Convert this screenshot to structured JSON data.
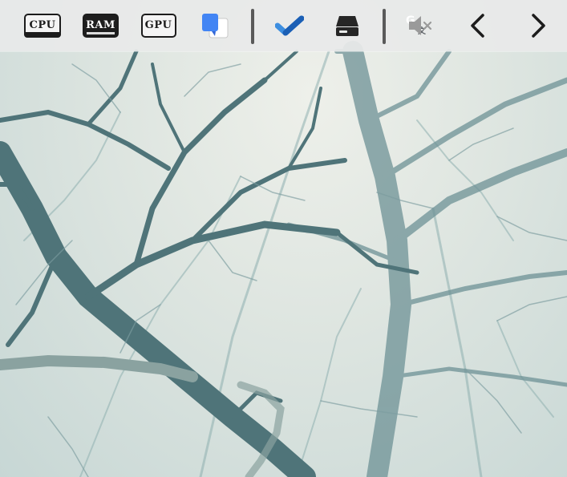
{
  "tray": {
    "cpu": {
      "label": "CPU",
      "icon": "cpu-monitor-icon"
    },
    "ram": {
      "label": "RAM",
      "icon": "ram-monitor-icon"
    },
    "gpu": {
      "label": "GPU",
      "icon": "gpu-monitor-icon"
    },
    "translate": {
      "label_g": "G",
      "label_x": "文",
      "icon": "google-translate-icon",
      "colors": {
        "blue": "#4285f4",
        "white": "#ffffff"
      }
    },
    "tasks": {
      "icon": "checkmark-tasks-icon",
      "colors": {
        "light": "#3d8ee0",
        "dark": "#1b5fb5"
      }
    },
    "drive": {
      "icon": "disk-drive-icon"
    },
    "volume": {
      "icon": "volume-muted-icon",
      "state": "muted"
    },
    "nav_prev": {
      "icon": "chevron-left-icon"
    },
    "nav_next": {
      "icon": "chevron-right-icon"
    }
  },
  "colors": {
    "bar_background": "#e8eae9",
    "icon_dark": "#1c1c1c",
    "separator": "#5a5a5a",
    "muted_icon": "#9a9a9a",
    "branch": "#4f7479"
  }
}
